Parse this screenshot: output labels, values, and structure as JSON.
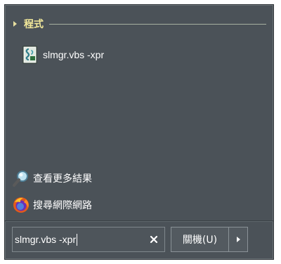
{
  "start_menu": {
    "section_title": "程式",
    "results": [
      {
        "label": "slmgr.vbs -xpr",
        "icon": "script-file-icon"
      }
    ],
    "see_more_label": "查看更多結果",
    "search_web_label": "搜尋網際網路",
    "search_value": "slmgr.vbs -xpr",
    "shutdown_label": "關機(U)"
  }
}
